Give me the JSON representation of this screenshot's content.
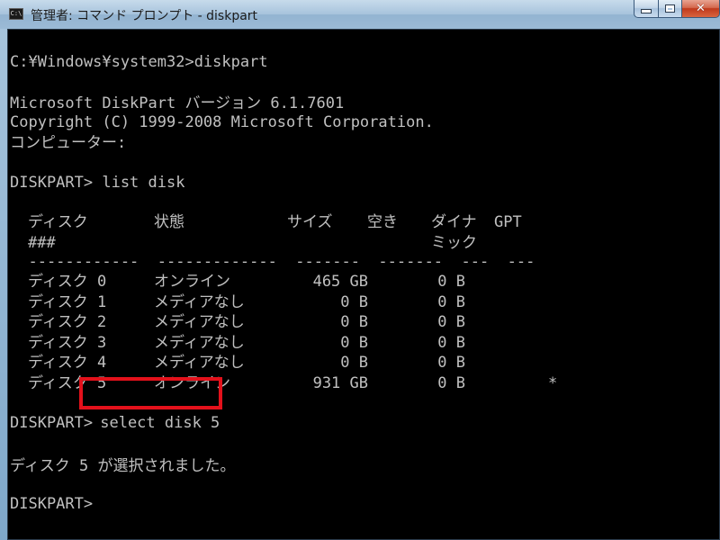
{
  "window": {
    "title": "管理者: コマンド プロンプト - diskpart",
    "icon": "cmd-icon",
    "icon_label": "C:\\",
    "controls": {
      "minimize": "minimize-icon",
      "maximize": "maximize-icon",
      "close_glyph": "✕"
    }
  },
  "console": {
    "cmd1": "C:¥Windows¥system32>diskpart",
    "version": "Microsoft DiskPart バージョン 6.1.7601",
    "copyright": "Copyright (C) 1999-2008 Microsoft Corporation.",
    "computer": "コンピューター:",
    "cmd2": "DISKPART> list disk",
    "table": {
      "headers": [
        "ディスク",
        "状態",
        "サイズ",
        "空き",
        "ダイナ",
        "GPT"
      ],
      "header_line2": [
        "###",
        "ミック"
      ],
      "separator": "  ------------  -------------  -------  -------  ---  ---",
      "rows": [
        {
          "disk": "ディスク 0",
          "status": "オンライン",
          "size": "465 GB",
          "free": "0 B",
          "dyn": "",
          "gpt": ""
        },
        {
          "disk": "ディスク 1",
          "status": "メディアなし",
          "size": "0 B",
          "free": "0 B",
          "dyn": "",
          "gpt": ""
        },
        {
          "disk": "ディスク 2",
          "status": "メディアなし",
          "size": "0 B",
          "free": "0 B",
          "dyn": "",
          "gpt": ""
        },
        {
          "disk": "ディスク 3",
          "status": "メディアなし",
          "size": "0 B",
          "free": "0 B",
          "dyn": "",
          "gpt": ""
        },
        {
          "disk": "ディスク 4",
          "status": "メディアなし",
          "size": "0 B",
          "free": "0 B",
          "dyn": "",
          "gpt": ""
        },
        {
          "disk": "ディスク 5",
          "status": "オンライン",
          "size": "931 GB",
          "free": "0 B",
          "dyn": "",
          "gpt": "*"
        }
      ]
    },
    "prompt3": "DISKPART>",
    "cmd3": " select disk 5",
    "result": "ディスク 5 が選択されました。",
    "prompt4": "DISKPART>"
  },
  "colors": {
    "console_bg": "#000000",
    "console_text": "#c0c0c0",
    "highlight": "#e3111b"
  }
}
